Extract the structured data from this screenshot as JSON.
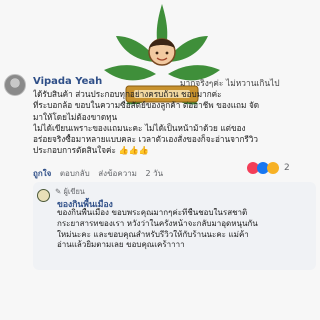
{
  "comment": {
    "author": "Vipada Yeah",
    "author_tail": "มากจริงๆค่ะ ไม่หวานเกินไป",
    "lines": [
      "ได้รับสินค้า ส่วนประกอบทุกอย่างครบถ้วน ชอบมากค่ะ",
      "ที่ระบอกล้อ ขอบในความซื่อสัตย์ของลูกค้า ต่ออาชีพ ของแถม จัด",
      "มาให้โดยไม่ต้องขาดทุน",
      "ไม่ได้เขียนเพราะของแถมนะคะ ไม่ได้เป็นหน้าม้าด้วย แต่ของ",
      "อร่อยจริงซื้อมาหลายแบบคละ เวลาตัวเองสั่งของก็จะอ่านจากรีวิว",
      "ประกอบการตัดสินใจค่ะ 👍👍👍"
    ],
    "actions": {
      "react": "ถูกใจ",
      "reply": "ตอบกลับ",
      "message": "ส่งข้อความ",
      "time": "2 วัน"
    },
    "reaction_count": "2"
  },
  "reply": {
    "badge": "ผู้เขียน",
    "name": "ของกินพื้นเมือง",
    "lines": [
      "ของกินพื้นเมือง ขอบพระคุณมากๆค่ะที่ชื่นชอบในรสชาติ",
      "กระยาสารทของเรา หวังว่าในครั้งหน้าจะกลับมาอุดหนุนกัน",
      "ใหม่นะคะ และขอบคุณสำหรับรีวิวให้กับร้านนะคะ แม่ค้า",
      "อ่านแล้วยิ้มตามเลย ขอบคุณเคร้าาาา"
    ]
  },
  "colors": {
    "link": "#2f4f88",
    "love": "#f33e58",
    "like": "#1877f2",
    "haha": "#f7b125",
    "reply_bg": "#f0f2f5"
  }
}
